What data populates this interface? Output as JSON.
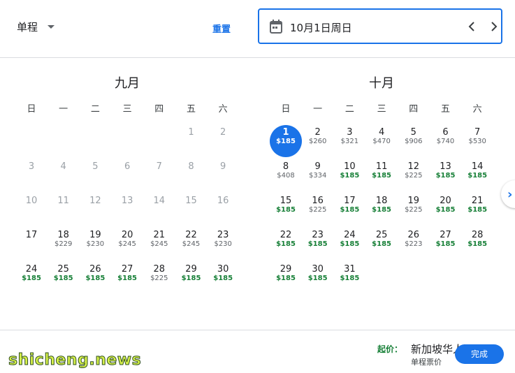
{
  "header": {
    "trip_type": "单程",
    "reset_label": "重置",
    "selected_date": "10月1日周日"
  },
  "calendar": {
    "weekdays": [
      "日",
      "一",
      "二",
      "三",
      "四",
      "五",
      "六"
    ],
    "months": [
      {
        "title": "九月",
        "days": [
          {
            "d": "1",
            "p": "",
            "state": "past",
            "col": 5,
            "row": 0
          },
          {
            "d": "2",
            "p": "",
            "state": "past",
            "col": 6,
            "row": 0
          },
          {
            "d": "3",
            "p": "",
            "state": "past",
            "col": 0,
            "row": 1
          },
          {
            "d": "4",
            "p": "",
            "state": "past",
            "col": 1,
            "row": 1
          },
          {
            "d": "5",
            "p": "",
            "state": "past",
            "col": 2,
            "row": 1
          },
          {
            "d": "6",
            "p": "",
            "state": "past",
            "col": 3,
            "row": 1
          },
          {
            "d": "7",
            "p": "",
            "state": "past",
            "col": 4,
            "row": 1
          },
          {
            "d": "8",
            "p": "",
            "state": "past",
            "col": 5,
            "row": 1
          },
          {
            "d": "9",
            "p": "",
            "state": "past",
            "col": 6,
            "row": 1
          },
          {
            "d": "10",
            "p": "",
            "state": "past",
            "col": 0,
            "row": 2
          },
          {
            "d": "11",
            "p": "",
            "state": "past",
            "col": 1,
            "row": 2
          },
          {
            "d": "12",
            "p": "",
            "state": "past",
            "col": 2,
            "row": 2
          },
          {
            "d": "13",
            "p": "",
            "state": "past",
            "col": 3,
            "row": 2
          },
          {
            "d": "14",
            "p": "",
            "state": "past",
            "col": 4,
            "row": 2
          },
          {
            "d": "15",
            "p": "",
            "state": "past",
            "col": 5,
            "row": 2
          },
          {
            "d": "16",
            "p": "",
            "state": "past",
            "col": 6,
            "row": 2
          },
          {
            "d": "17",
            "p": "",
            "state": "normal",
            "col": 0,
            "row": 3
          },
          {
            "d": "18",
            "p": "$229",
            "state": "normal",
            "col": 1,
            "row": 3
          },
          {
            "d": "19",
            "p": "$230",
            "state": "normal",
            "col": 2,
            "row": 3
          },
          {
            "d": "20",
            "p": "$245",
            "state": "normal",
            "col": 3,
            "row": 3
          },
          {
            "d": "21",
            "p": "$245",
            "state": "normal",
            "col": 4,
            "row": 3
          },
          {
            "d": "22",
            "p": "$245",
            "state": "normal",
            "col": 5,
            "row": 3
          },
          {
            "d": "23",
            "p": "$230",
            "state": "normal",
            "col": 6,
            "row": 3
          },
          {
            "d": "24",
            "p": "$185",
            "state": "low",
            "col": 0,
            "row": 4
          },
          {
            "d": "25",
            "p": "$185",
            "state": "low",
            "col": 1,
            "row": 4
          },
          {
            "d": "26",
            "p": "$185",
            "state": "low",
            "col": 2,
            "row": 4
          },
          {
            "d": "27",
            "p": "$185",
            "state": "low",
            "col": 3,
            "row": 4
          },
          {
            "d": "28",
            "p": "$225",
            "state": "normal",
            "col": 4,
            "row": 4
          },
          {
            "d": "29",
            "p": "$185",
            "state": "low",
            "col": 5,
            "row": 4
          },
          {
            "d": "30",
            "p": "$185",
            "state": "low",
            "col": 6,
            "row": 4
          }
        ]
      },
      {
        "title": "十月",
        "days": [
          {
            "d": "1",
            "p": "$185",
            "state": "selected",
            "col": 0,
            "row": 0
          },
          {
            "d": "2",
            "p": "$260",
            "state": "normal",
            "col": 1,
            "row": 0
          },
          {
            "d": "3",
            "p": "$321",
            "state": "normal",
            "col": 2,
            "row": 0
          },
          {
            "d": "4",
            "p": "$470",
            "state": "normal",
            "col": 3,
            "row": 0
          },
          {
            "d": "5",
            "p": "$906",
            "state": "normal",
            "col": 4,
            "row": 0
          },
          {
            "d": "6",
            "p": "$740",
            "state": "normal",
            "col": 5,
            "row": 0
          },
          {
            "d": "7",
            "p": "$530",
            "state": "normal",
            "col": 6,
            "row": 0
          },
          {
            "d": "8",
            "p": "$408",
            "state": "normal",
            "col": 0,
            "row": 1
          },
          {
            "d": "9",
            "p": "$334",
            "state": "normal",
            "col": 1,
            "row": 1
          },
          {
            "d": "10",
            "p": "$185",
            "state": "low",
            "col": 2,
            "row": 1
          },
          {
            "d": "11",
            "p": "$185",
            "state": "low",
            "col": 3,
            "row": 1
          },
          {
            "d": "12",
            "p": "$225",
            "state": "normal",
            "col": 4,
            "row": 1
          },
          {
            "d": "13",
            "p": "$185",
            "state": "low",
            "col": 5,
            "row": 1
          },
          {
            "d": "14",
            "p": "$185",
            "state": "low",
            "col": 6,
            "row": 1
          },
          {
            "d": "15",
            "p": "$185",
            "state": "low",
            "col": 0,
            "row": 2
          },
          {
            "d": "16",
            "p": "$225",
            "state": "normal",
            "col": 1,
            "row": 2
          },
          {
            "d": "17",
            "p": "$185",
            "state": "low",
            "col": 2,
            "row": 2
          },
          {
            "d": "18",
            "p": "$185",
            "state": "low",
            "col": 3,
            "row": 2
          },
          {
            "d": "19",
            "p": "$225",
            "state": "normal",
            "col": 4,
            "row": 2
          },
          {
            "d": "20",
            "p": "$185",
            "state": "low",
            "col": 5,
            "row": 2
          },
          {
            "d": "21",
            "p": "$185",
            "state": "low",
            "col": 6,
            "row": 2
          },
          {
            "d": "22",
            "p": "$185",
            "state": "low",
            "col": 0,
            "row": 3
          },
          {
            "d": "23",
            "p": "$185",
            "state": "low",
            "col": 1,
            "row": 3
          },
          {
            "d": "24",
            "p": "$185",
            "state": "low",
            "col": 2,
            "row": 3
          },
          {
            "d": "25",
            "p": "$185",
            "state": "low",
            "col": 3,
            "row": 3
          },
          {
            "d": "26",
            "p": "$223",
            "state": "normal",
            "col": 4,
            "row": 3
          },
          {
            "d": "27",
            "p": "$185",
            "state": "low",
            "col": 5,
            "row": 3
          },
          {
            "d": "28",
            "p": "$185",
            "state": "low",
            "col": 6,
            "row": 3
          },
          {
            "d": "29",
            "p": "$185",
            "state": "low",
            "col": 0,
            "row": 4
          },
          {
            "d": "30",
            "p": "$185",
            "state": "low",
            "col": 1,
            "row": 4
          },
          {
            "d": "31",
            "p": "$185",
            "state": "low",
            "col": 2,
            "row": 4
          }
        ]
      }
    ]
  },
  "footer": {
    "price_from": "起价：",
    "oneway_label": "单程票价",
    "done_label": "完成",
    "watermark_wechat": "新加坡华人圈",
    "watermark_site": "shicheng.news"
  },
  "colors": {
    "accent": "#1a73e8",
    "low_price": "#188038",
    "past_day": "#9aa0a6"
  },
  "icons": [
    "calendar-icon",
    "chevron-left-icon",
    "chevron-right-icon",
    "dropdown-caret-icon"
  ]
}
